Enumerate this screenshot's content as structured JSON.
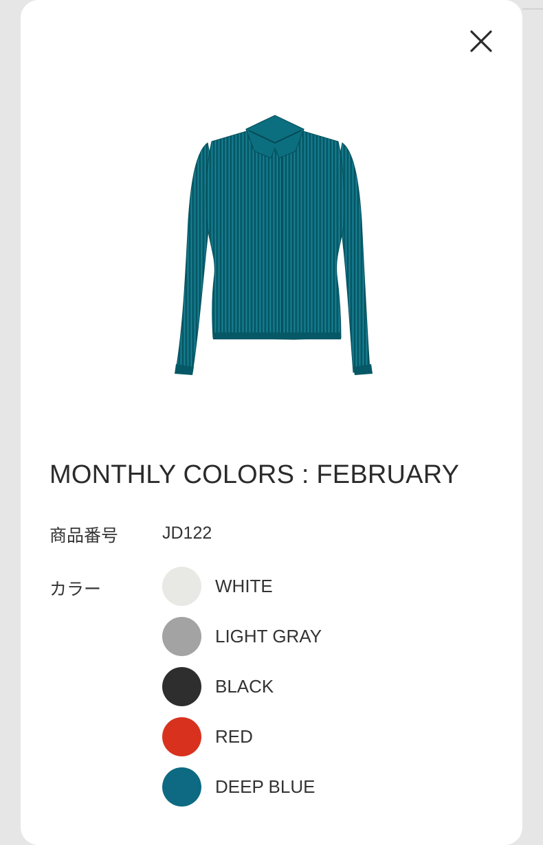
{
  "modal": {
    "close_icon": "close-icon",
    "product": {
      "image_icon": "teal-pleated-jacket",
      "title": "MONTHLY COLORS : FEBRUARY",
      "code_label": "商品番号",
      "code_value": "JD122",
      "color_label": "カラー",
      "colors": [
        {
          "name": "WHITE",
          "hex": "#e8e9e4"
        },
        {
          "name": "LIGHT GRAY",
          "hex": "#a3a3a3"
        },
        {
          "name": "BLACK",
          "hex": "#2e2e2e"
        },
        {
          "name": "RED",
          "hex": "#d8321f"
        },
        {
          "name": "DEEP BLUE",
          "hex": "#0d6a82"
        }
      ]
    }
  }
}
